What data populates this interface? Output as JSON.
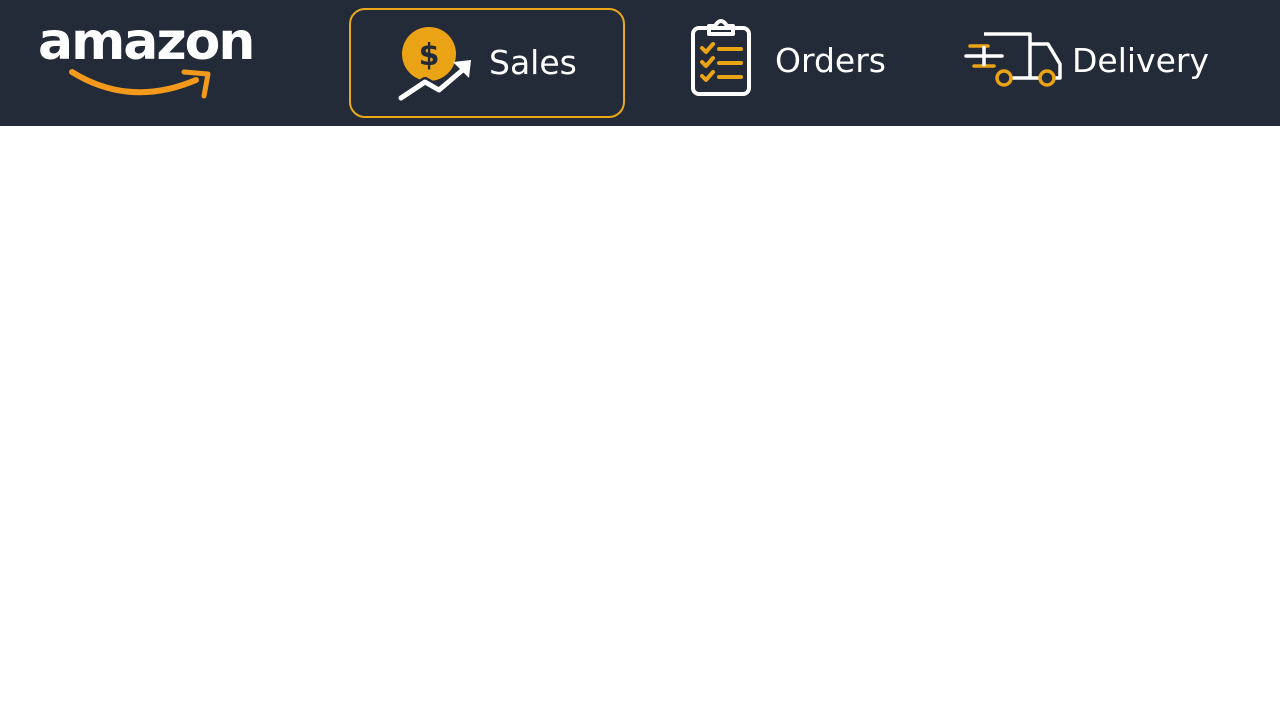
{
  "brand": {
    "name": "amazon",
    "text_color": "#ffffff",
    "smile_color": "#f39a1c"
  },
  "nav": {
    "accent": "#e8a81a",
    "background": "#232b38",
    "tabs": [
      {
        "label": "Sales",
        "icon": "sales-growth-icon",
        "active": true
      },
      {
        "label": "Orders",
        "icon": "clipboard-checklist-icon",
        "active": false
      },
      {
        "label": "Delivery",
        "icon": "delivery-truck-icon",
        "active": false
      }
    ]
  }
}
